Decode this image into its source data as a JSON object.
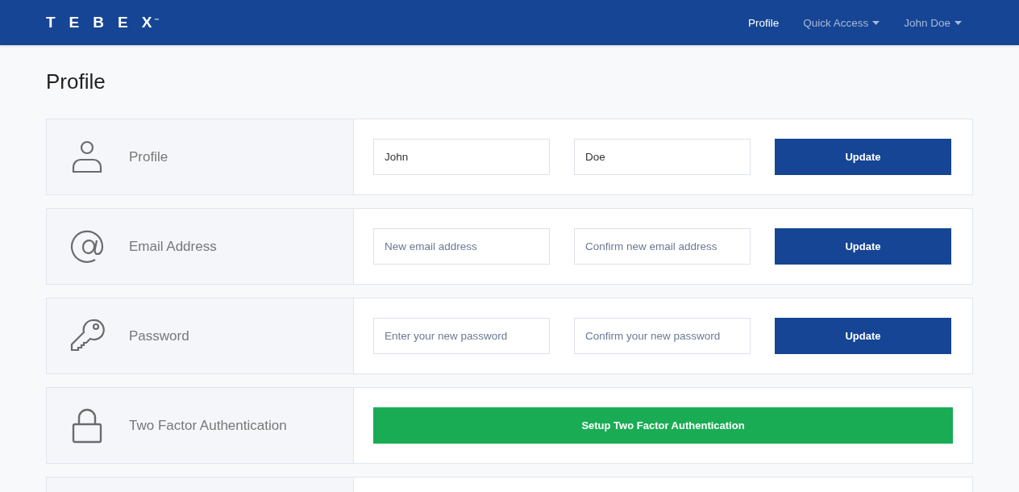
{
  "navbar": {
    "brand": "TEBEX",
    "brand_mark": "™",
    "items": [
      {
        "label": "Profile",
        "selected": true,
        "dropdown": false
      },
      {
        "label": "Quick Access",
        "selected": false,
        "dropdown": true
      },
      {
        "label": "John Doe",
        "selected": false,
        "dropdown": true
      }
    ]
  },
  "page_title": "Profile",
  "sections": [
    {
      "kind": "fields",
      "label": "Profile",
      "fields": [
        {
          "value": "John"
        },
        {
          "value": "Doe"
        }
      ],
      "button": "Update"
    },
    {
      "kind": "fields",
      "label": "Email Address",
      "fields": [
        {
          "placeholder": "New email address"
        },
        {
          "placeholder": "Confirm new email address"
        }
      ],
      "button": "Update"
    },
    {
      "kind": "fields",
      "label": "Password",
      "fields": [
        {
          "placeholder": "Enter your new password"
        },
        {
          "placeholder": "Confirm your new password"
        }
      ],
      "button": "Update"
    },
    {
      "kind": "action",
      "label": "Two Factor Authentication",
      "button": "Setup Two Factor Authentication"
    }
  ]
}
